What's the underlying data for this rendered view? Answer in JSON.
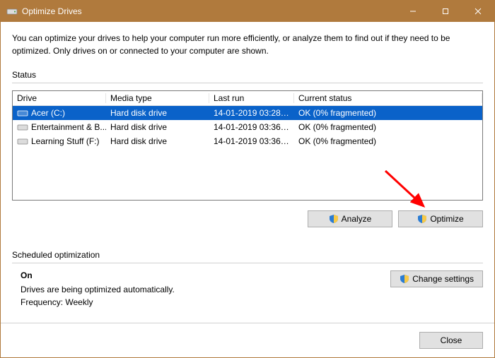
{
  "window": {
    "title": "Optimize Drives"
  },
  "intro": "You can optimize your drives to help your computer run more efficiently, or analyze them to find out if they need to be optimized. Only drives on or connected to your computer are shown.",
  "status": {
    "label": "Status",
    "headers": {
      "drive": "Drive",
      "media": "Media type",
      "last": "Last run",
      "status": "Current status"
    },
    "rows": [
      {
        "drive": "Acer (C:)",
        "media": "Hard disk drive",
        "last": "14-01-2019 03:28 P...",
        "status": "OK (0% fragmented)",
        "selected": true
      },
      {
        "drive": "Entertainment & B...",
        "media": "Hard disk drive",
        "last": "14-01-2019 03:36 P...",
        "status": "OK (0% fragmented)",
        "selected": false
      },
      {
        "drive": "Learning Stuff (F:)",
        "media": "Hard disk drive",
        "last": "14-01-2019 03:36 P...",
        "status": "OK (0% fragmented)",
        "selected": false
      }
    ]
  },
  "buttons": {
    "analyze": "Analyze",
    "optimize": "Optimize",
    "change_settings": "Change settings",
    "close": "Close"
  },
  "scheduled": {
    "label": "Scheduled optimization",
    "on": "On",
    "desc": "Drives are being optimized automatically.",
    "freq": "Frequency: Weekly"
  }
}
